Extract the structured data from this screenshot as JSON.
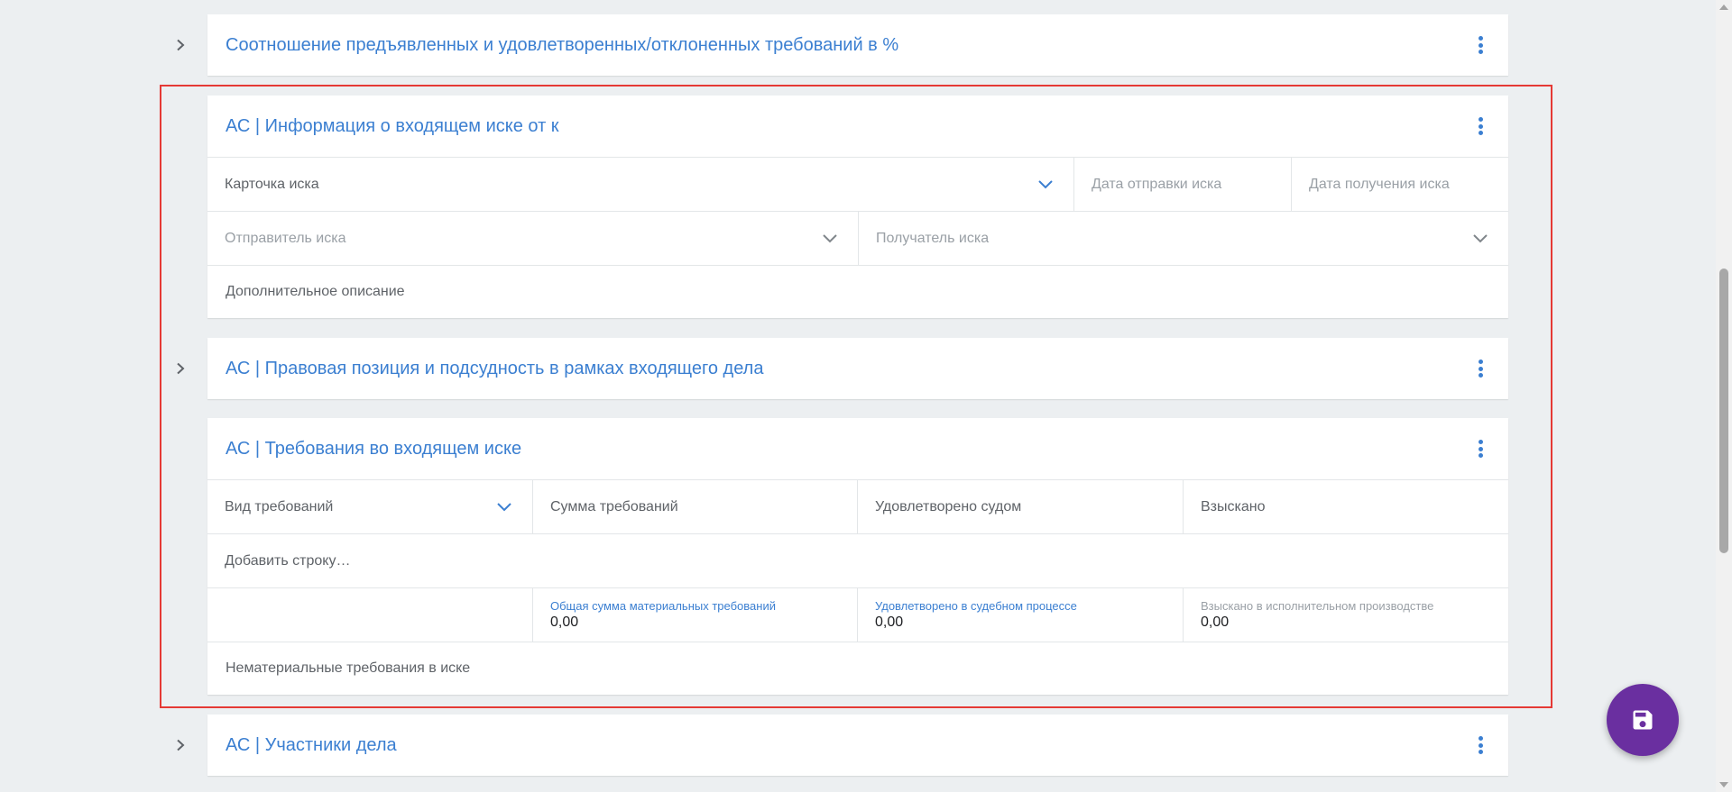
{
  "sections": {
    "ratio": {
      "title": "Соотношение предъявленных и удовлетворенных/отклоненных требований в %"
    },
    "claim_info": {
      "title": "АС | Информация о входящем иске от к",
      "claim_card": "Карточка иска",
      "send_date_placeholder": "Дата отправки иска",
      "receive_date_placeholder": "Дата получения иска",
      "sender_placeholder": "Отправитель иска",
      "receiver_placeholder": "Получатель иска",
      "additional_description": "Дополнительное описание"
    },
    "legal_position": {
      "title": "АС | Правовая позиция и подсудность в рамках входящего дела"
    },
    "requirements": {
      "title": "АС | Требования во входящем иске",
      "columns": [
        "Вид требований",
        "Сумма требований",
        "Удовлетворено судом",
        "Взыскано"
      ],
      "add_row": "Добавить строку…",
      "totals": [
        {
          "label": "Общая сумма материальных требований",
          "value": "0,00"
        },
        {
          "label": "Удовлетворено в судебном процессе",
          "value": "0,00"
        },
        {
          "label": "Взыскано в исполнительном производстве",
          "value": "0,00"
        }
      ],
      "non_material": "Нематериальные требования в иске"
    },
    "participants": {
      "title": "АС | Участники дела"
    }
  },
  "colors": {
    "accent": "#3b7fd1",
    "fab": "#6a2fa0",
    "highlight": "#e53935",
    "background": "#eceff1"
  },
  "icons": {
    "expand": "chevron-right-icon",
    "menu": "more-vertical-icon",
    "dropdown": "chevron-down-icon",
    "save": "floppy-disk-icon"
  }
}
